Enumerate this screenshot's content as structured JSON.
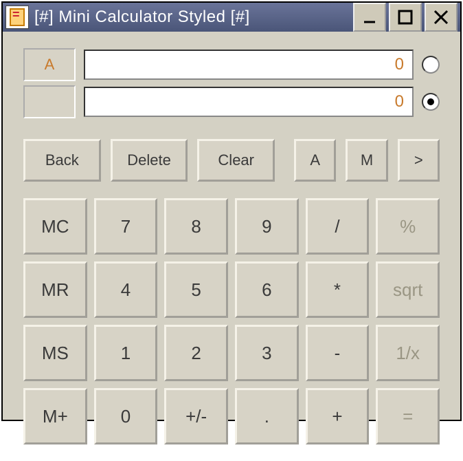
{
  "window": {
    "title": "[#] Mini Calculator Styled [#]"
  },
  "displays": {
    "a": {
      "label": "A",
      "value": "0",
      "selected": false
    },
    "b": {
      "label": "",
      "value": "0",
      "selected": true
    }
  },
  "edit": {
    "back": "Back",
    "delete": "Delete",
    "clear": "Clear",
    "mode_a": "A",
    "mode_m": "M",
    "more": ">"
  },
  "keypad": {
    "rows": [
      [
        "MC",
        "7",
        "8",
        "9",
        "/",
        "%"
      ],
      [
        "MR",
        "4",
        "5",
        "6",
        "*",
        "sqrt"
      ],
      [
        "MS",
        "1",
        "2",
        "3",
        "-",
        "1/x"
      ],
      [
        "M+",
        "0",
        "+/-",
        ".",
        "+",
        "="
      ]
    ]
  }
}
